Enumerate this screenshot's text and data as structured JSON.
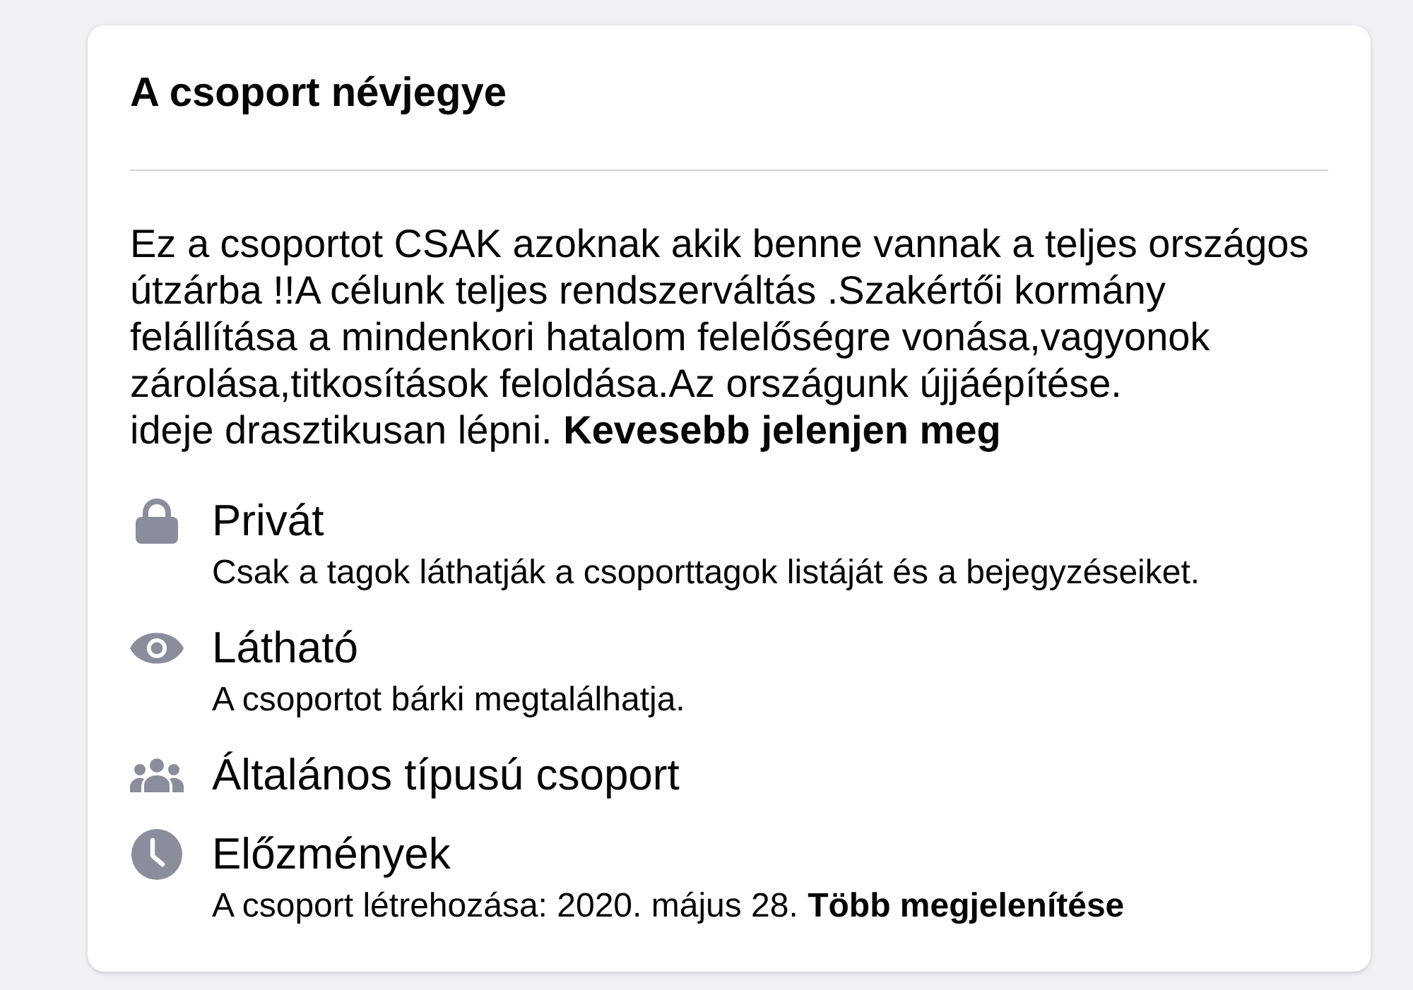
{
  "card": {
    "title": "A csoport névjegye",
    "description": {
      "text": "Ez a csoportot CSAK azoknak akik benne vannak a teljes országos útzárba !!A célunk teljes rendszerváltás .Szakértői kormány felállítása a mindenkori hatalom felelőségre vonása,vagyonok zárolása,titkosítások feloldása.Az országunk újjáépítése.\nideje drasztikusan lépni.",
      "link": "Kevesebb jelenjen meg"
    },
    "items": [
      {
        "kind": "privacy",
        "title": "Privát",
        "subtitle": "Csak a tagok láthatják a csoporttagok listáját és a bejegyzéseiket."
      },
      {
        "kind": "visibility",
        "title": "Látható",
        "subtitle": "A csoportot bárki megtalálhatja."
      },
      {
        "kind": "type",
        "title": "Általános típusú csoport"
      },
      {
        "kind": "history",
        "title": "Előzmények",
        "subtitle": "A csoport létrehozása: 2020. május 28.",
        "link": "Több megjelenítése"
      }
    ]
  }
}
